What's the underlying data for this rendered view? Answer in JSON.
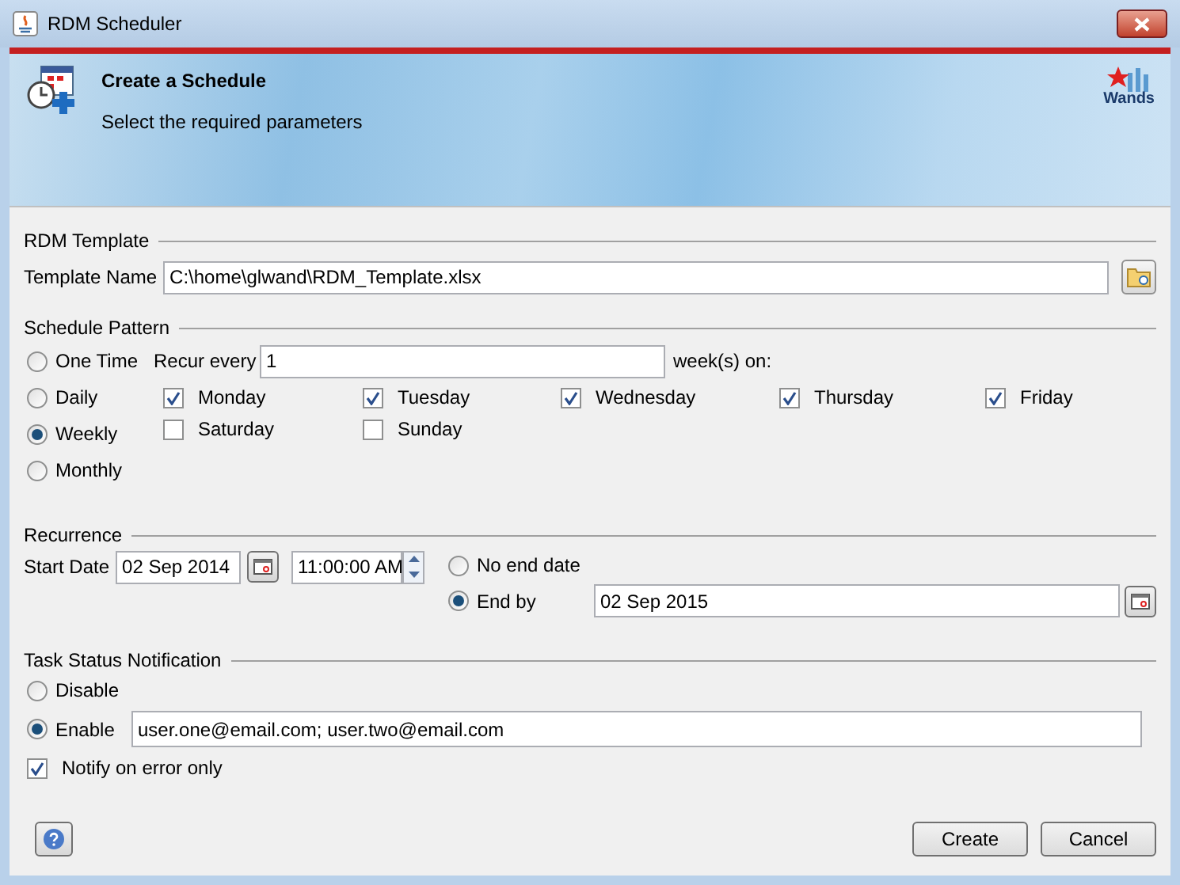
{
  "window": {
    "title": "RDM Scheduler"
  },
  "header": {
    "title": "Create a Schedule",
    "subtitle": "Select the required parameters",
    "logo": "Wands"
  },
  "template": {
    "heading": "RDM Template",
    "label": "Template Name",
    "value": "C:\\home\\glwand\\RDM_Template.xlsx"
  },
  "schedule": {
    "heading": "Schedule Pattern",
    "patterns": [
      {
        "label": "One Time",
        "selected": false
      },
      {
        "label": "Daily",
        "selected": false
      },
      {
        "label": "Weekly",
        "selected": true
      },
      {
        "label": "Monthly",
        "selected": false
      }
    ],
    "recur_label": "Recur every",
    "recur_value": "1",
    "recur_suffix": "week(s) on:",
    "days": [
      {
        "label": "Monday",
        "checked": true
      },
      {
        "label": "Tuesday",
        "checked": true
      },
      {
        "label": "Wednesday",
        "checked": true
      },
      {
        "label": "Thursday",
        "checked": true
      },
      {
        "label": "Friday",
        "checked": true
      },
      {
        "label": "Saturday",
        "checked": false
      },
      {
        "label": "Sunday",
        "checked": false
      }
    ]
  },
  "recurrence": {
    "heading": "Recurrence",
    "start_label": "Start Date",
    "start_date": "02 Sep 2014",
    "start_time": "11:00:00 AM",
    "end_options": [
      {
        "label": "No end date",
        "selected": false
      },
      {
        "label": "End by",
        "selected": true
      }
    ],
    "end_date": "02 Sep 2015"
  },
  "notification": {
    "heading": "Task Status Notification",
    "options": [
      {
        "label": "Disable",
        "selected": false
      },
      {
        "label": "Enable",
        "selected": true
      }
    ],
    "emails": "user.one@email.com; user.two@email.com",
    "error_only": {
      "label": "Notify on error only",
      "checked": true
    }
  },
  "buttons": [
    "Create",
    "Cancel"
  ]
}
